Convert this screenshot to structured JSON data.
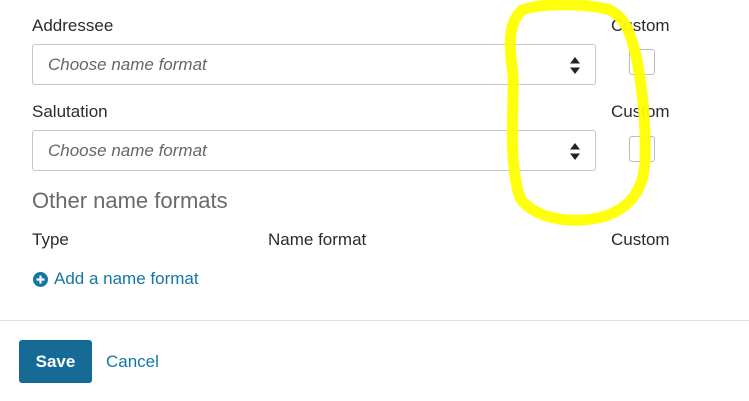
{
  "form": {
    "addressee": {
      "label": "Addressee",
      "placeholder": "Choose name format",
      "custom_label": "Custom"
    },
    "salutation": {
      "label": "Salutation",
      "placeholder": "Choose name format",
      "custom_label": "Custom"
    }
  },
  "other_formats": {
    "title": "Other name formats",
    "columns": {
      "type": "Type",
      "name_format": "Name format",
      "custom": "Custom"
    },
    "add_link": "Add a name format",
    "add_icon": "plus-circle-icon"
  },
  "footer": {
    "save_label": "Save",
    "cancel_label": "Cancel"
  },
  "colors": {
    "accent": "#156b96",
    "link": "#1476a6",
    "annotation": "#ffff00"
  }
}
